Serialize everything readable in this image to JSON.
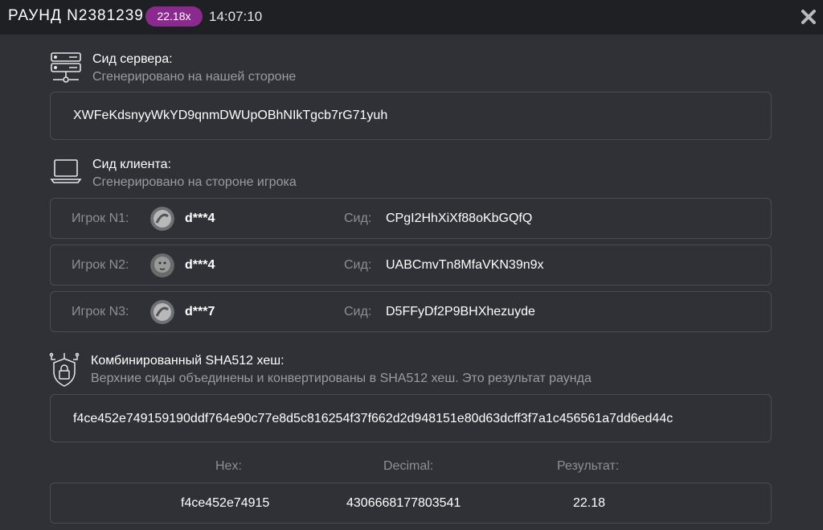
{
  "header": {
    "round_title": "РАУНД N2381239",
    "multiplier": "22.18x",
    "time": "14:07:10"
  },
  "server_seed": {
    "title": "Сид сервера:",
    "subtitle": "Сгенерировано на нашей стороне",
    "value": "XWFeKdsnyyWkYD9qnmDWUpOBhNIkTgcb7rG71yuh"
  },
  "client_seed": {
    "title": "Сид клиента:",
    "subtitle": "Сгенерировано на стороне игрока",
    "seed_label": "Сид:",
    "players": [
      {
        "label": "Игрок N1:",
        "name": "d***4",
        "seed": "CPgI2HhXiXf88oKbGQfQ"
      },
      {
        "label": "Игрок N2:",
        "name": "d***4",
        "seed": "UABCmvTn8MfaVKN39n9x"
      },
      {
        "label": "Игрок N3:",
        "name": "d***7",
        "seed": "D5FFyDf2P9BHXhezuyde"
      }
    ]
  },
  "combined_hash": {
    "title": "Комбинированный SHA512 хеш:",
    "subtitle": "Верхние сиды объединены и конвертированы в SHA512 хеш. Это результат раунда",
    "value": "f4ce452e749159190ddf764e90c77e8d5c816254f37f662d2d948151e80d63dcff3f7a1c456561a7dd6ed44c"
  },
  "result": {
    "hex_label": "Hex:",
    "decimal_label": "Decimal:",
    "result_label": "Результат:",
    "hex": "f4ce452e74915",
    "decimal": "4306668177803541",
    "result": "22.18"
  },
  "colors": {
    "accent": "#8a2a8e",
    "background": "#2f3136",
    "header": "#1f2023",
    "muted_text": "#9b9ca0"
  }
}
